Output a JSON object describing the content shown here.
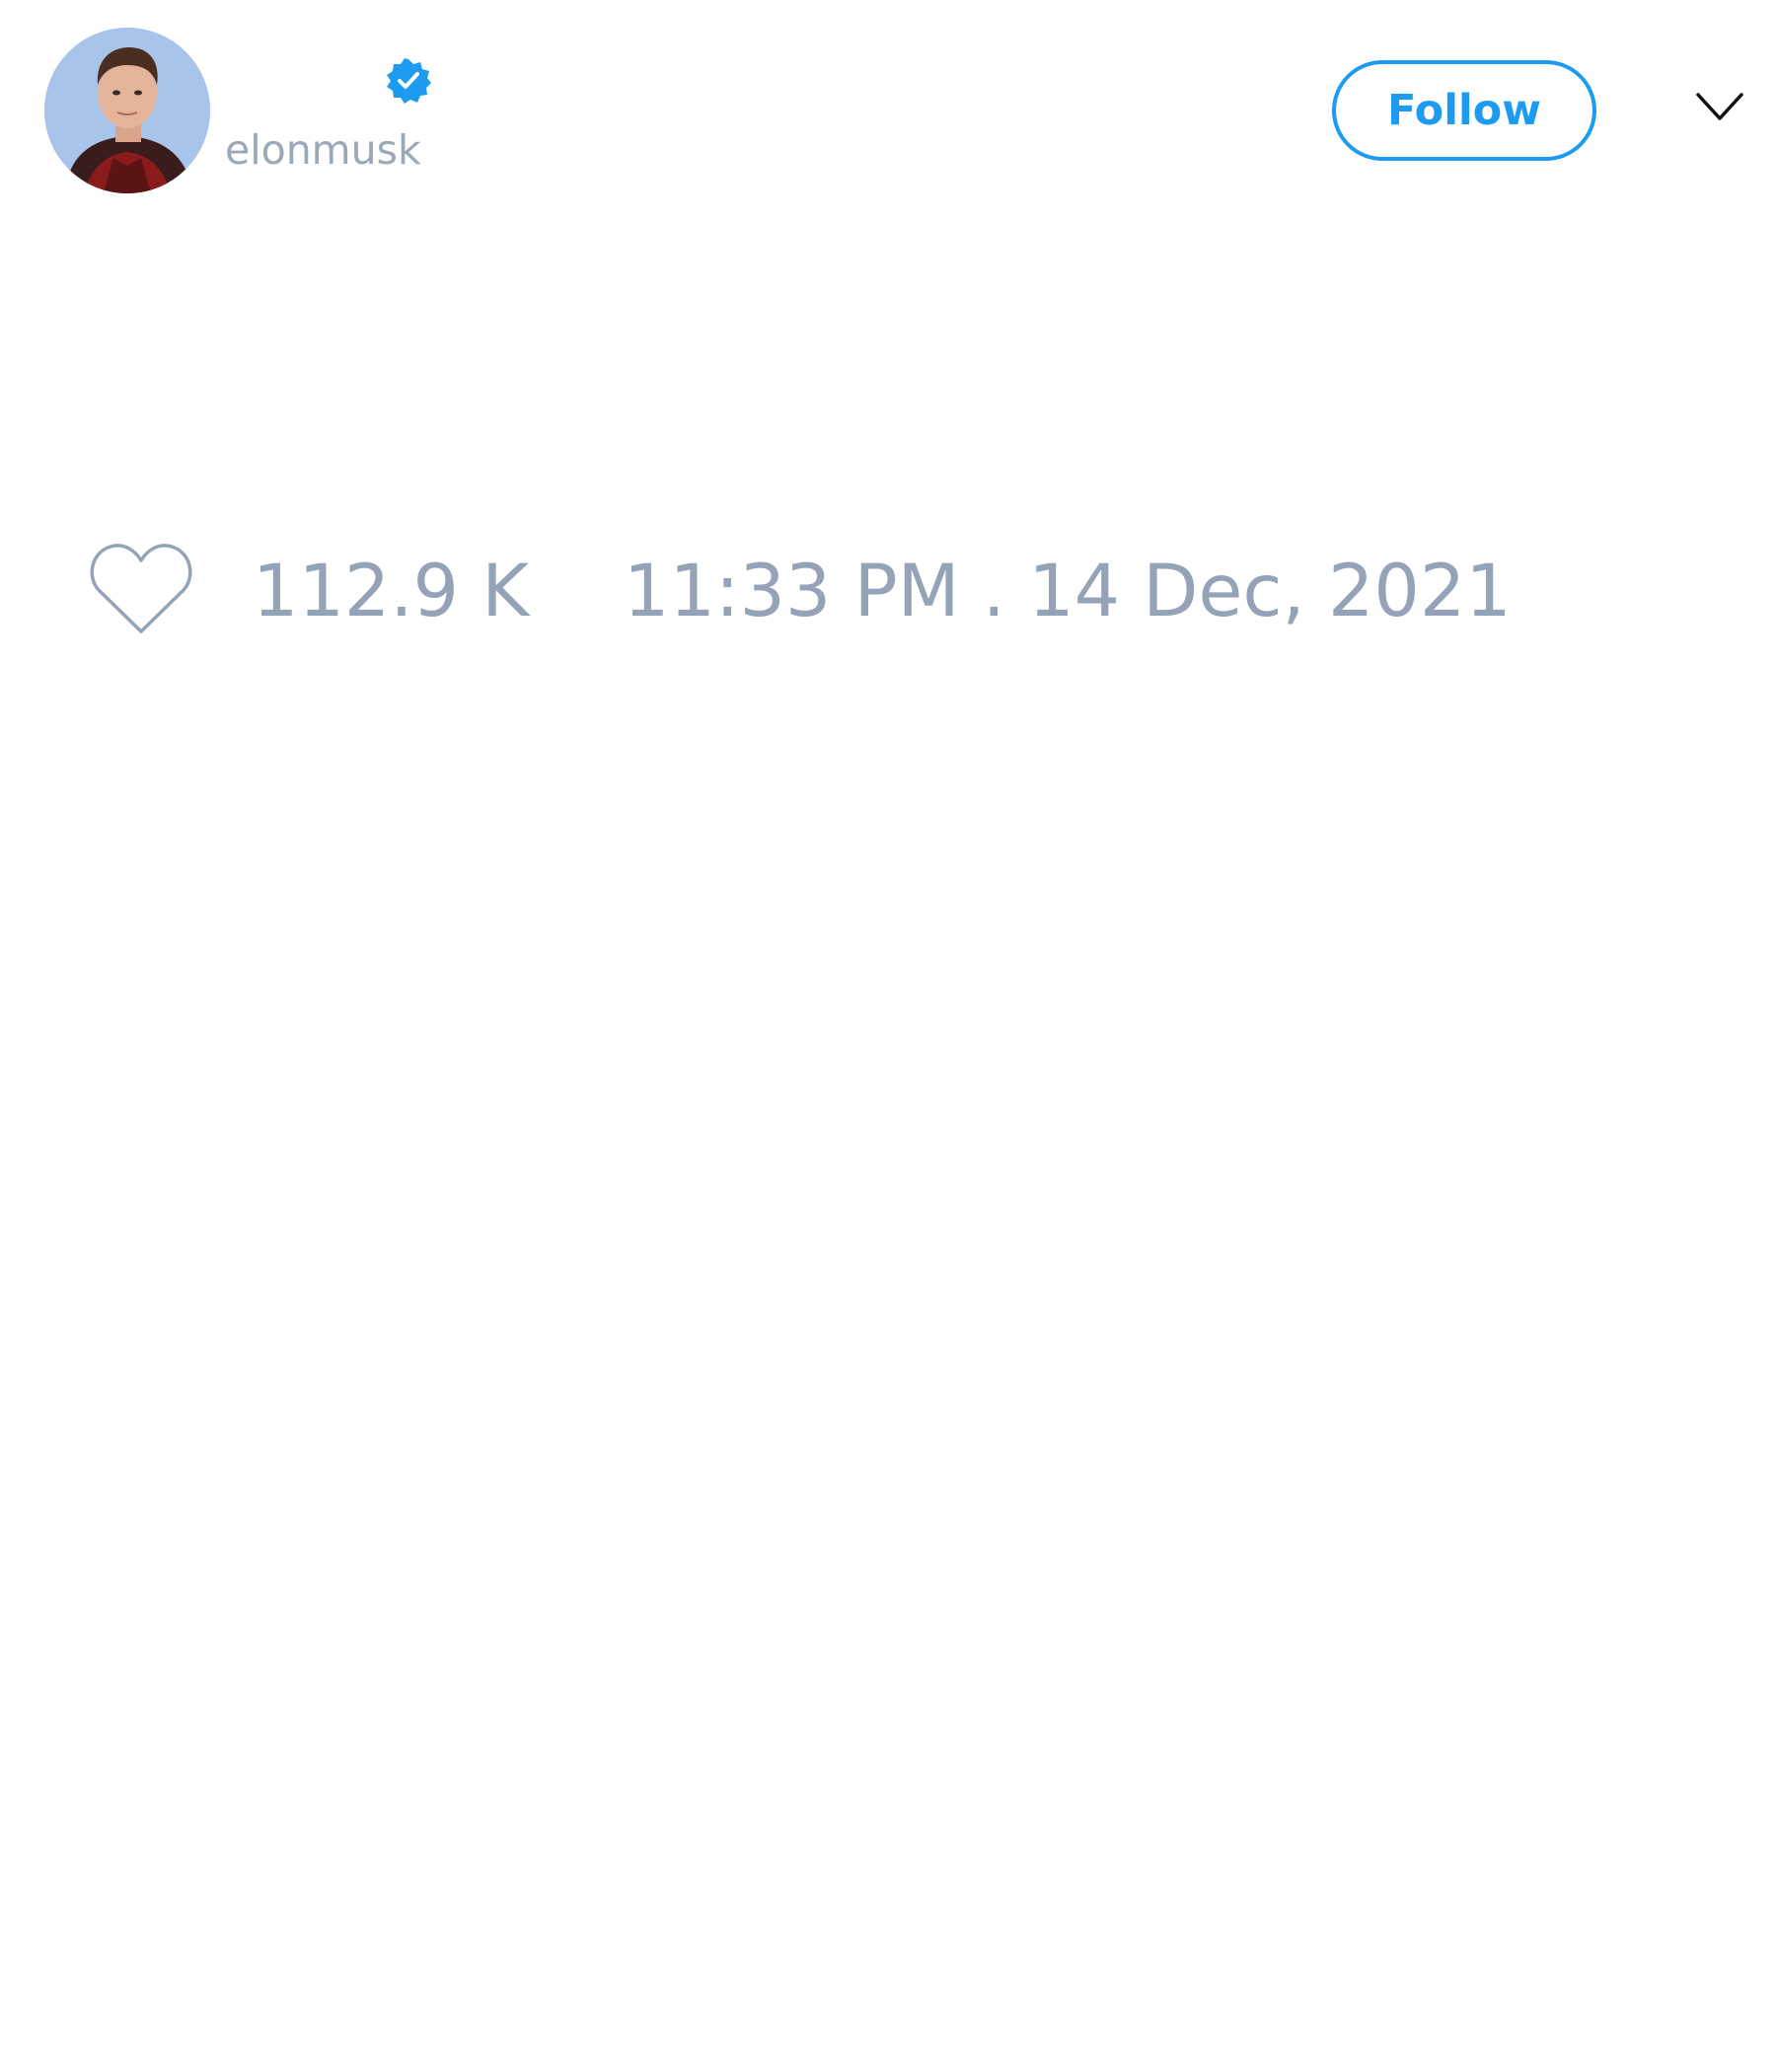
{
  "user": {
    "handle": "elonmusk",
    "verified": true
  },
  "header": {
    "follow_label": "Follow",
    "icons": {
      "verified": "verified-badge-icon",
      "menu": "chevron-down-icon"
    }
  },
  "footer": {
    "like_count": "112.9 K",
    "timestamp": "11:33 PM . 14 Dec, 2021",
    "icons": {
      "like": "heart-icon"
    }
  },
  "colors": {
    "accent": "#1d9bf0",
    "muted_text": "#94a3b8",
    "background": "#ffffff"
  }
}
